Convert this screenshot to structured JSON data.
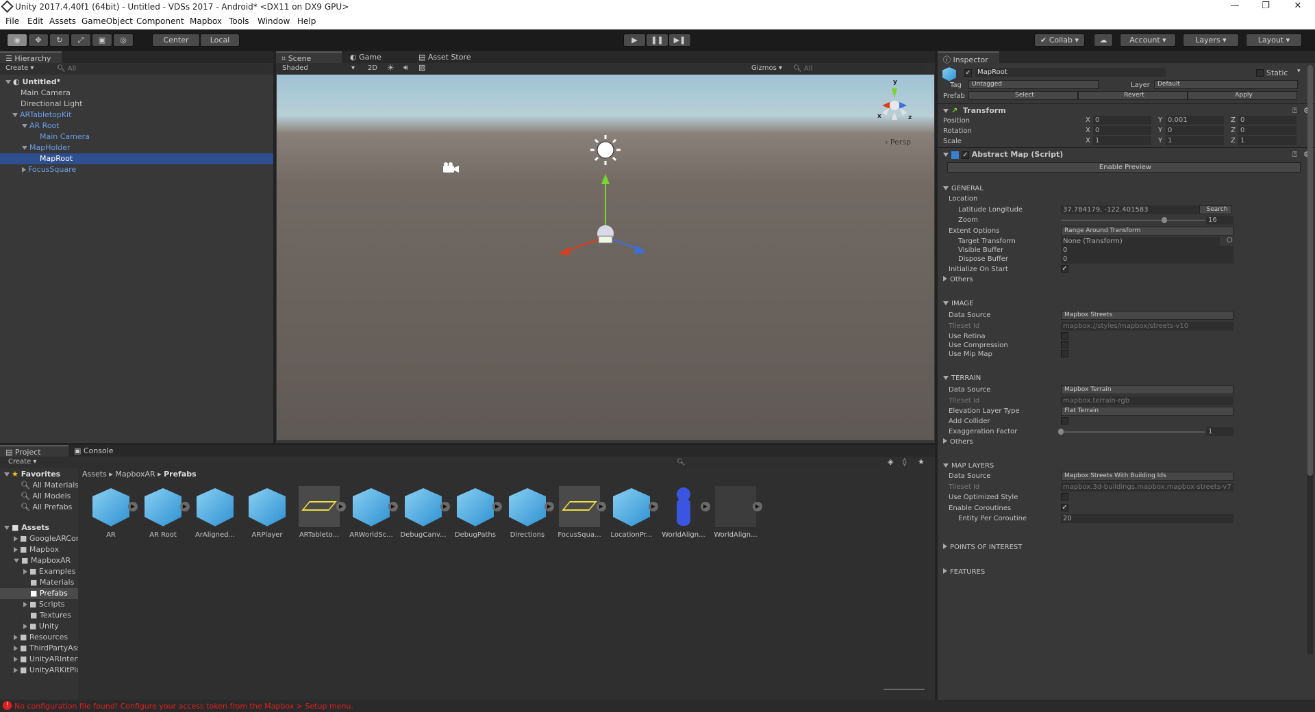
{
  "window": {
    "title": "Unity 2017.4.40f1 (64bit) - Untitled - VDSs 2017 - Android* <DX11 on DX9 GPU>"
  },
  "menu": [
    "File",
    "Edit",
    "Assets",
    "GameObject",
    "Component",
    "Mapbox",
    "Tools",
    "Window",
    "Help"
  ],
  "toolbar": {
    "center": "Center",
    "local": "Local",
    "collab": "Collab",
    "account": "Account",
    "layers": "Layers",
    "layout": "Layout"
  },
  "hierarchy": {
    "tab": "Hierarchy",
    "create": "Create",
    "search": "All",
    "scene": "Untitled*",
    "items": [
      "Main Camera",
      "Directional Light",
      "ARTabletopKit",
      "AR Root",
      "Main Camera",
      "MapHolder",
      "MapRoot",
      "FocusSquare"
    ]
  },
  "scene": {
    "tabs": [
      "Scene",
      "Game",
      "Asset Store"
    ],
    "shaded": "Shaded",
    "mode2d": "2D",
    "gizmos": "Gizmos",
    "search": "All",
    "persp": "Persp",
    "axis_x": "x",
    "axis_z": "z",
    "axis_y": "y"
  },
  "project": {
    "tabs": [
      "Project",
      "Console"
    ],
    "create": "Create",
    "breadcrumb": [
      "Assets",
      "MapboxAR",
      "Prefabs"
    ],
    "favorites_label": "Favorites",
    "favorites": [
      "All Materials",
      "All Models",
      "All Prefabs"
    ],
    "assets_label": "Assets",
    "folders": [
      "GoogleARCore",
      "Mapbox",
      "MapboxAR",
      "Examples",
      "Materials",
      "Prefabs",
      "Scripts",
      "Textures",
      "Unity",
      "Resources",
      "ThirdPartyAssets",
      "UnityARInterface",
      "UnityARKitPlugin"
    ],
    "items": [
      "AR",
      "AR Root",
      "ArAligned...",
      "ARPlayer",
      "ARTableto...",
      "ARWorldSc...",
      "DebugCanv...",
      "DebugPaths",
      "Directions",
      "FocusSqua...",
      "LocationPr...",
      "WorldAlign...",
      "WorldAlign..."
    ]
  },
  "status": {
    "error": "No configuration file found! Configure your access token from the Mapbox > Setup menu."
  },
  "inspector": {
    "tab": "Inspector",
    "object": "MapRoot",
    "static": "Static",
    "tag_label": "Tag",
    "tag": "Untagged",
    "layer_label": "Layer",
    "layer": "Default",
    "prefab_label": "Prefab",
    "prefab_select": "Select",
    "prefab_revert": "Revert",
    "prefab_apply": "Apply",
    "transform": {
      "title": "Transform",
      "position": "Position",
      "rotation": "Rotation",
      "scale": "Scale",
      "pos": [
        "0",
        "0.001",
        "0"
      ],
      "rot": [
        "0",
        "0",
        "0"
      ],
      "scl": [
        "1",
        "1",
        "1"
      ],
      "x": "X",
      "y": "Y",
      "z": "Z"
    },
    "script": {
      "title": "Abstract Map (Script)",
      "preview": "Enable Preview"
    },
    "general": {
      "title": "GENERAL",
      "location": "Location",
      "latlon_label": "Latitude Longitude",
      "latlon": "37.784179, -122.401583",
      "search": "Search",
      "zoom_label": "Zoom",
      "zoom": "16",
      "zoom_fraction": 0.72,
      "extent_label": "Extent Options",
      "extent": "Range Around Transform",
      "target_label": "Target Transform",
      "target": "None (Transform)",
      "visible_label": "Visible Buffer",
      "visible": "0",
      "dispose_label": "Dispose Buffer",
      "dispose": "0",
      "init_label": "Initialize On Start",
      "others": "Others"
    },
    "image": {
      "title": "IMAGE",
      "source_label": "Data Source",
      "source": "Mapbox Streets",
      "tileset_label": "Tileset Id",
      "tileset": "mapbox://styles/mapbox/streets-v10",
      "retina": "Use Retina",
      "compression": "Use Compression",
      "mipmap": "Use Mip Map"
    },
    "terrain": {
      "title": "TERRAIN",
      "source_label": "Data Source",
      "source": "Mapbox Terrain",
      "tileset_label": "Tileset Id",
      "tileset": "mapbox.terrain-rgb",
      "elev_label": "Elevation Layer Type",
      "elev": "Flat Terrain",
      "collider": "Add Collider",
      "exag_label": "Exaggeration Factor",
      "exag": "1",
      "exag_fraction": 0.0,
      "others": "Others"
    },
    "layers": {
      "title": "MAP LAYERS",
      "source_label": "Data Source",
      "source": "Mapbox Streets With Building Ids",
      "tileset_label": "Tileset Id",
      "tileset": "mapbox.3d-buildings,mapbox.mapbox-streets-v7",
      "optimized": "Use Optimized Style",
      "coroutines": "Enable Coroutines",
      "entity_label": "Entity Per Coroutine",
      "entity": "20"
    },
    "poi": "POINTS OF INTEREST",
    "features": "FEATURES"
  },
  "colors": {
    "selection": "#2e4f8f",
    "error": "#e02020",
    "accent_blue": "#6c9eea"
  }
}
